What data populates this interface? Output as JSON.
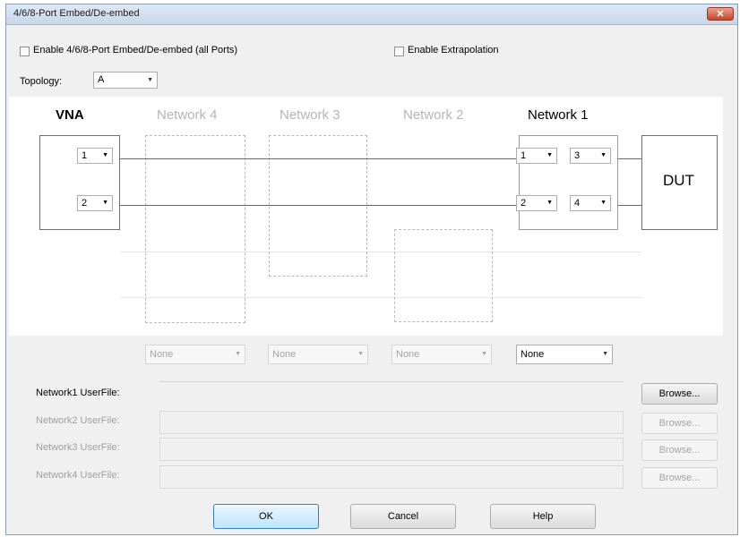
{
  "window": {
    "title": "4/6/8-Port Embed/De-embed",
    "close_glyph": "✕"
  },
  "options": {
    "enable_embed_label": "Enable 4/6/8-Port Embed/De-embed (all Ports)",
    "enable_embed_checked": false,
    "enable_extrapolation_label": "Enable Extrapolation",
    "enable_extrapolation_checked": false,
    "topology_label": "Topology:",
    "topology_value": "A"
  },
  "diagram": {
    "vna_label": "VNA",
    "network4_label": "Network 4",
    "network3_label": "Network 3",
    "network2_label": "Network 2",
    "network1_label": "Network 1",
    "dut_label": "DUT",
    "vna_port1": "1",
    "vna_port2": "2",
    "net1_port_left_top": "1",
    "net1_port_left_bottom": "2",
    "net1_port_right_top": "3",
    "net1_port_right_bottom": "4"
  },
  "network_selectors": {
    "network4": "None",
    "network3": "None",
    "network2": "None",
    "network1": "None"
  },
  "userfiles": {
    "network1_label": "Network1 UserFile:",
    "network2_label": "Network2 UserFile:",
    "network3_label": "Network3 UserFile:",
    "network4_label": "Network4 UserFile:",
    "browse_label": "Browse..."
  },
  "buttons": {
    "ok": "OK",
    "cancel": "Cancel",
    "help": "Help"
  },
  "icons": {
    "dropdown_arrow": "chevron-down-icon"
  }
}
